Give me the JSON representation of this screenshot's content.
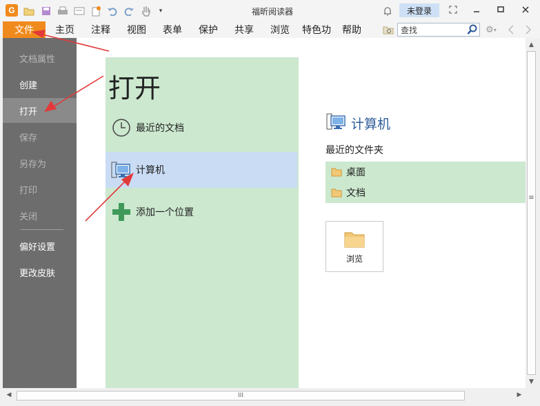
{
  "window": {
    "title": "福昕阅读器",
    "login": "未登录"
  },
  "menu": {
    "items": [
      "文件",
      "主页",
      "注释",
      "视图",
      "表单",
      "保护",
      "共享",
      "浏览",
      "特色功",
      "帮助"
    ],
    "search_value": "查找"
  },
  "sidebar": {
    "items": [
      {
        "label": "文档属性",
        "state": "disabled"
      },
      {
        "label": "创建",
        "state": "enabled"
      },
      {
        "label": "打开",
        "state": "selected"
      },
      {
        "label": "保存",
        "state": "disabled"
      },
      {
        "label": "另存为",
        "state": "disabled"
      },
      {
        "label": "打印",
        "state": "disabled"
      },
      {
        "label": "关闭",
        "state": "disabled"
      },
      {
        "label": "偏好设置",
        "state": "enabled"
      },
      {
        "label": "更改皮肤",
        "state": "enabled"
      }
    ]
  },
  "open_panel": {
    "title": "打开",
    "options": [
      {
        "label": "最近的文档",
        "icon": "clock-icon"
      },
      {
        "label": "计算机",
        "icon": "computer-icon"
      },
      {
        "label": "添加一个位置",
        "icon": "plus-icon"
      }
    ]
  },
  "computer_panel": {
    "title": "计算机",
    "recent_folders_label": "最近的文件夹",
    "folders": [
      "桌面",
      "文档"
    ],
    "browse_label": "浏览"
  },
  "scrollbar": {
    "h_thumb_label": "III",
    "v_thumb_label": "≡"
  },
  "colors": {
    "accent": "#f08a1c",
    "sidebar": "#6d6d6d",
    "panel_green": "#cce8cf",
    "selected_blue": "#c9dcf4",
    "title_blue": "#2e5c9a"
  }
}
